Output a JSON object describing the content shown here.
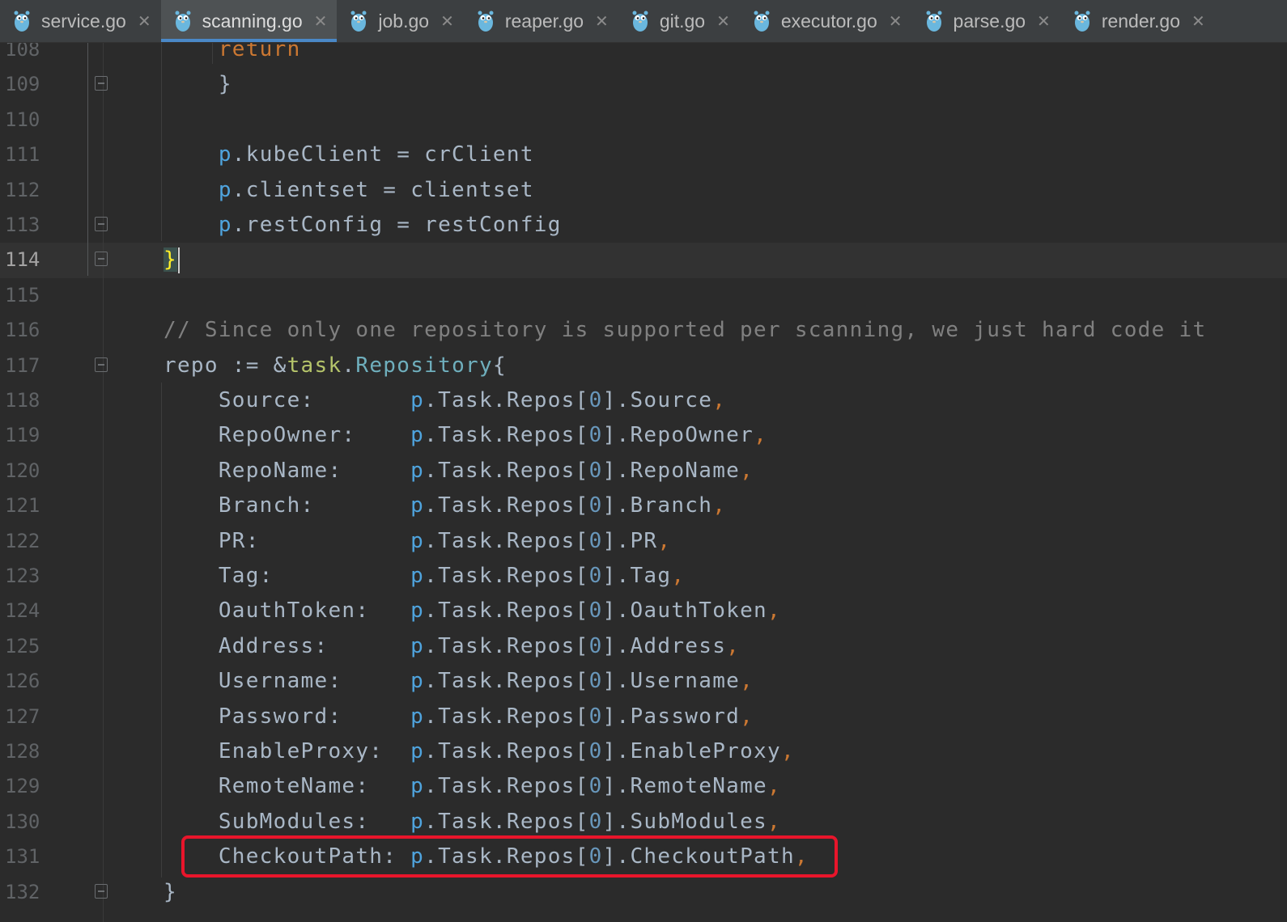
{
  "tabs": [
    {
      "label": "service.go",
      "active": false
    },
    {
      "label": "scanning.go",
      "active": true
    },
    {
      "label": "job.go",
      "active": false
    },
    {
      "label": "reaper.go",
      "active": false
    },
    {
      "label": "git.go",
      "active": false
    },
    {
      "label": "executor.go",
      "active": false
    },
    {
      "label": "parse.go",
      "active": false
    },
    {
      "label": "render.go",
      "active": false
    }
  ],
  "editor": {
    "current_line": "114",
    "lines": [
      {
        "n": "108",
        "tokens": [
          [
            "    return",
            "kw"
          ]
        ]
      },
      {
        "n": "109",
        "tokens": [
          [
            "    }",
            "plain"
          ]
        ]
      },
      {
        "n": "110",
        "tokens": []
      },
      {
        "n": "111",
        "tokens": [
          [
            "    ",
            "plain"
          ],
          [
            "p",
            "recv"
          ],
          [
            ".kubeClient = crClient",
            "plain"
          ]
        ]
      },
      {
        "n": "112",
        "tokens": [
          [
            "    ",
            "plain"
          ],
          [
            "p",
            "recv"
          ],
          [
            ".clientset = clientset",
            "plain"
          ]
        ]
      },
      {
        "n": "113",
        "tokens": [
          [
            "    ",
            "plain"
          ],
          [
            "p",
            "recv"
          ],
          [
            ".restConfig = restConfig",
            "plain"
          ]
        ]
      },
      {
        "n": "114",
        "tokens": [
          [
            "}",
            "brace"
          ]
        ]
      },
      {
        "n": "115",
        "tokens": []
      },
      {
        "n": "116",
        "tokens": [
          [
            "// Since only one repository is supported per scanning, we just hard code it",
            "comment"
          ]
        ]
      },
      {
        "n": "117",
        "tokens": [
          [
            "repo := &",
            "plain"
          ],
          [
            "task",
            "pkg"
          ],
          [
            ".",
            "plain"
          ],
          [
            "Repository",
            "type"
          ],
          [
            "{",
            "plain"
          ]
        ]
      },
      {
        "n": "118",
        "tokens": [
          [
            "    Source:       ",
            "plain"
          ],
          [
            "p",
            "recv"
          ],
          [
            ".Task.Repos[",
            "plain"
          ],
          [
            "0",
            "num"
          ],
          [
            "].Source",
            "plain"
          ],
          [
            ",",
            "punct"
          ]
        ]
      },
      {
        "n": "119",
        "tokens": [
          [
            "    RepoOwner:    ",
            "plain"
          ],
          [
            "p",
            "recv"
          ],
          [
            ".Task.Repos[",
            "plain"
          ],
          [
            "0",
            "num"
          ],
          [
            "].RepoOwner",
            "plain"
          ],
          [
            ",",
            "punct"
          ]
        ]
      },
      {
        "n": "120",
        "tokens": [
          [
            "    RepoName:     ",
            "plain"
          ],
          [
            "p",
            "recv"
          ],
          [
            ".Task.Repos[",
            "plain"
          ],
          [
            "0",
            "num"
          ],
          [
            "].RepoName",
            "plain"
          ],
          [
            ",",
            "punct"
          ]
        ]
      },
      {
        "n": "121",
        "tokens": [
          [
            "    Branch:       ",
            "plain"
          ],
          [
            "p",
            "recv"
          ],
          [
            ".Task.Repos[",
            "plain"
          ],
          [
            "0",
            "num"
          ],
          [
            "].Branch",
            "plain"
          ],
          [
            ",",
            "punct"
          ]
        ]
      },
      {
        "n": "122",
        "tokens": [
          [
            "    PR:           ",
            "plain"
          ],
          [
            "p",
            "recv"
          ],
          [
            ".Task.Repos[",
            "plain"
          ],
          [
            "0",
            "num"
          ],
          [
            "].PR",
            "plain"
          ],
          [
            ",",
            "punct"
          ]
        ]
      },
      {
        "n": "123",
        "tokens": [
          [
            "    Tag:          ",
            "plain"
          ],
          [
            "p",
            "recv"
          ],
          [
            ".Task.Repos[",
            "plain"
          ],
          [
            "0",
            "num"
          ],
          [
            "].Tag",
            "plain"
          ],
          [
            ",",
            "punct"
          ]
        ]
      },
      {
        "n": "124",
        "tokens": [
          [
            "    OauthToken:   ",
            "plain"
          ],
          [
            "p",
            "recv"
          ],
          [
            ".Task.Repos[",
            "plain"
          ],
          [
            "0",
            "num"
          ],
          [
            "].OauthToken",
            "plain"
          ],
          [
            ",",
            "punct"
          ]
        ]
      },
      {
        "n": "125",
        "tokens": [
          [
            "    Address:      ",
            "plain"
          ],
          [
            "p",
            "recv"
          ],
          [
            ".Task.Repos[",
            "plain"
          ],
          [
            "0",
            "num"
          ],
          [
            "].Address",
            "plain"
          ],
          [
            ",",
            "punct"
          ]
        ]
      },
      {
        "n": "126",
        "tokens": [
          [
            "    Username:     ",
            "plain"
          ],
          [
            "p",
            "recv"
          ],
          [
            ".Task.Repos[",
            "plain"
          ],
          [
            "0",
            "num"
          ],
          [
            "].Username",
            "plain"
          ],
          [
            ",",
            "punct"
          ]
        ]
      },
      {
        "n": "127",
        "tokens": [
          [
            "    Password:     ",
            "plain"
          ],
          [
            "p",
            "recv"
          ],
          [
            ".Task.Repos[",
            "plain"
          ],
          [
            "0",
            "num"
          ],
          [
            "].Password",
            "plain"
          ],
          [
            ",",
            "punct"
          ]
        ]
      },
      {
        "n": "128",
        "tokens": [
          [
            "    EnableProxy:  ",
            "plain"
          ],
          [
            "p",
            "recv"
          ],
          [
            ".Task.Repos[",
            "plain"
          ],
          [
            "0",
            "num"
          ],
          [
            "].EnableProxy",
            "plain"
          ],
          [
            ",",
            "punct"
          ]
        ]
      },
      {
        "n": "129",
        "tokens": [
          [
            "    RemoteName:   ",
            "plain"
          ],
          [
            "p",
            "recv"
          ],
          [
            ".Task.Repos[",
            "plain"
          ],
          [
            "0",
            "num"
          ],
          [
            "].RemoteName",
            "plain"
          ],
          [
            ",",
            "punct"
          ]
        ]
      },
      {
        "n": "130",
        "tokens": [
          [
            "    SubModules:   ",
            "plain"
          ],
          [
            "p",
            "recv"
          ],
          [
            ".Task.Repos[",
            "plain"
          ],
          [
            "0",
            "num"
          ],
          [
            "].SubModules",
            "plain"
          ],
          [
            ",",
            "punct"
          ]
        ]
      },
      {
        "n": "131",
        "tokens": [
          [
            "    CheckoutPath: ",
            "plain"
          ],
          [
            "p",
            "recv"
          ],
          [
            ".Task.Repos[",
            "plain"
          ],
          [
            "0",
            "num"
          ],
          [
            "].CheckoutPath",
            "plain"
          ],
          [
            ",",
            "punct"
          ]
        ]
      },
      {
        "n": "132",
        "tokens": [
          [
            "}",
            "plain"
          ]
        ]
      }
    ]
  },
  "colors": {
    "plain": "#a9b7c6",
    "kw": "#cc7832",
    "recv": "#4fa4de",
    "num": "#6897bb",
    "punct": "#cc7832",
    "comment": "#808080",
    "pkg": "#b5c46a",
    "type": "#6fafbd",
    "brace": "#ffef28",
    "highlight_box": "#e8152b",
    "tab_accent": "#4a88c7"
  }
}
